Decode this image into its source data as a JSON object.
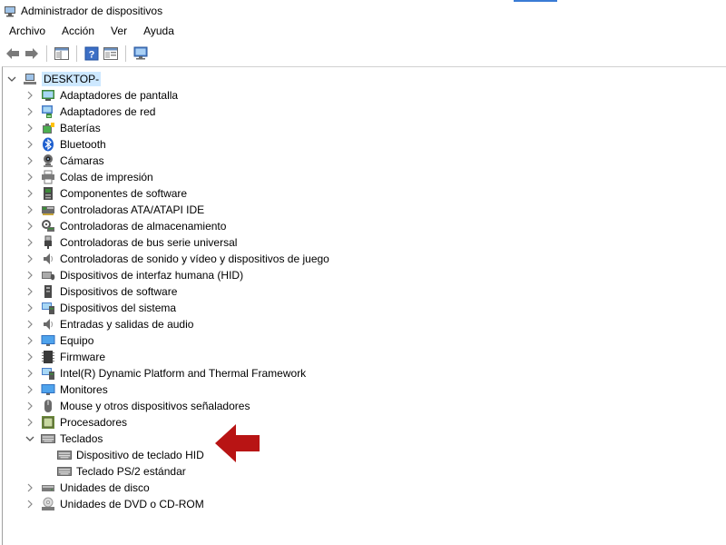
{
  "window": {
    "title": "Administrador de dispositivos"
  },
  "menu": [
    "Archivo",
    "Acción",
    "Ver",
    "Ayuda"
  ],
  "tree": {
    "root": "DESKTOP-",
    "categories": [
      {
        "label": "Adaptadores de pantalla",
        "icon": "display-adapter-icon",
        "expanded": false
      },
      {
        "label": "Adaptadores de red",
        "icon": "network-adapter-icon",
        "expanded": false
      },
      {
        "label": "Baterías",
        "icon": "battery-icon",
        "expanded": false
      },
      {
        "label": "Bluetooth",
        "icon": "bluetooth-icon",
        "expanded": false
      },
      {
        "label": "Cámaras",
        "icon": "camera-icon",
        "expanded": false
      },
      {
        "label": "Colas de impresión",
        "icon": "printer-icon",
        "expanded": false
      },
      {
        "label": "Componentes de software",
        "icon": "software-component-icon",
        "expanded": false
      },
      {
        "label": "Controladoras ATA/ATAPI IDE",
        "icon": "ide-controller-icon",
        "expanded": false
      },
      {
        "label": "Controladoras de almacenamiento",
        "icon": "storage-controller-icon",
        "expanded": false
      },
      {
        "label": "Controladoras de bus serie universal",
        "icon": "usb-icon",
        "expanded": false
      },
      {
        "label": "Controladoras de sonido y vídeo y dispositivos de juego",
        "icon": "speaker-icon",
        "expanded": false
      },
      {
        "label": "Dispositivos de interfaz humana (HID)",
        "icon": "hid-icon",
        "expanded": false
      },
      {
        "label": "Dispositivos de software",
        "icon": "software-device-icon",
        "expanded": false
      },
      {
        "label": "Dispositivos del sistema",
        "icon": "system-device-icon",
        "expanded": false
      },
      {
        "label": "Entradas y salidas de audio",
        "icon": "audio-io-icon",
        "expanded": false
      },
      {
        "label": "Equipo",
        "icon": "computer-icon",
        "expanded": false
      },
      {
        "label": "Firmware",
        "icon": "firmware-icon",
        "expanded": false
      },
      {
        "label": "Intel(R) Dynamic Platform and Thermal Framework",
        "icon": "system-device-icon",
        "expanded": false
      },
      {
        "label": "Monitores",
        "icon": "monitor-icon",
        "expanded": false
      },
      {
        "label": "Mouse y otros dispositivos señaladores",
        "icon": "mouse-icon",
        "expanded": false
      },
      {
        "label": "Procesadores",
        "icon": "processor-icon",
        "expanded": false
      },
      {
        "label": "Teclados",
        "icon": "keyboard-icon",
        "expanded": true,
        "children": [
          {
            "label": "Dispositivo de teclado HID",
            "icon": "keyboard-icon"
          },
          {
            "label": "Teclado PS/2 estándar",
            "icon": "keyboard-icon"
          }
        ]
      },
      {
        "label": "Unidades de disco",
        "icon": "disk-drive-icon",
        "expanded": false
      },
      {
        "label": "Unidades de DVD o CD-ROM",
        "icon": "dvd-drive-icon",
        "expanded": false
      }
    ]
  },
  "colors": {
    "selection": "#cde8ff",
    "arrow": "#b81414"
  }
}
